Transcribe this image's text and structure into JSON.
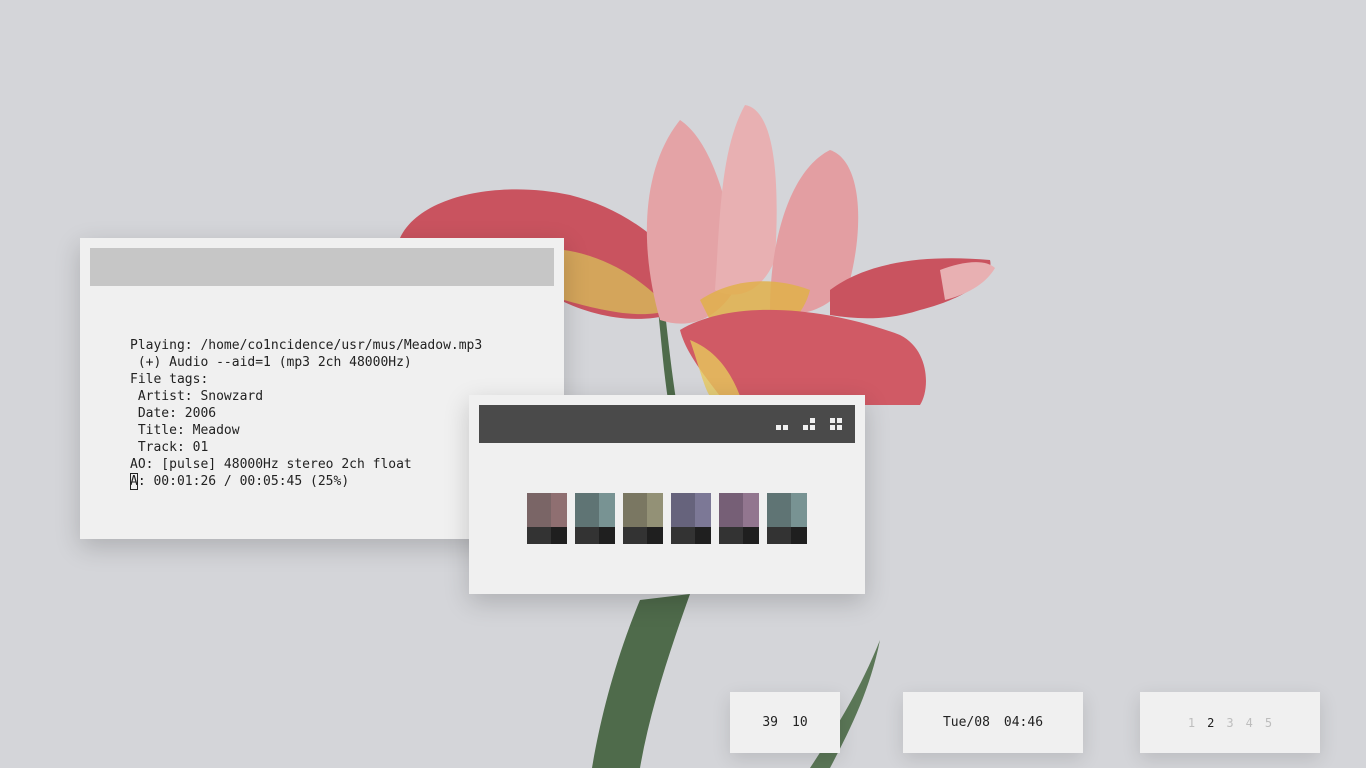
{
  "wallpaper": {
    "background": "#d4d5d9",
    "petal_color": "#c9535f",
    "petal_light_color": "#e4a3a6",
    "stem_color": "#4f6b4b"
  },
  "terminal": {
    "lines": [
      "Playing: /home/co1ncidence/usr/mus/Meadow.mp3",
      " (+) Audio --aid=1 (mp3 2ch 48000Hz)",
      "File tags:",
      " Artist: Snowzard",
      " Date: 2006",
      " Title: Meadow",
      " Track: 01",
      "AO: [pulse] 48000Hz stereo 2ch float"
    ],
    "status_cursor_char": "A",
    "status_rest": ": 00:01:26 / 00:05:45 (25%)",
    "titlebar_color": "#c6c6c6"
  },
  "palette_window": {
    "titlebar_color": "#4a4a4a",
    "layout_icons": [
      "layout-horizontal-icon",
      "layout-stair-icon",
      "layout-grid-icon"
    ],
    "swatches": [
      {
        "left": "#7a6566",
        "right": "#8f6f71"
      },
      {
        "left": "#5f7474",
        "right": "#789393"
      },
      {
        "left": "#7a7762",
        "right": "#939176"
      },
      {
        "left": "#66637c",
        "right": "#7c7896"
      },
      {
        "left": "#765f76",
        "right": "#92768f"
      },
      {
        "left": "#5f7474",
        "right": "#789393"
      }
    ]
  },
  "bars": {
    "stats": {
      "a": "39",
      "b": "10"
    },
    "clock": {
      "date": "Tue/08",
      "time": "04:46"
    },
    "workspaces": {
      "items": [
        "1",
        "2",
        "3",
        "4",
        "5"
      ],
      "active": "2"
    }
  }
}
